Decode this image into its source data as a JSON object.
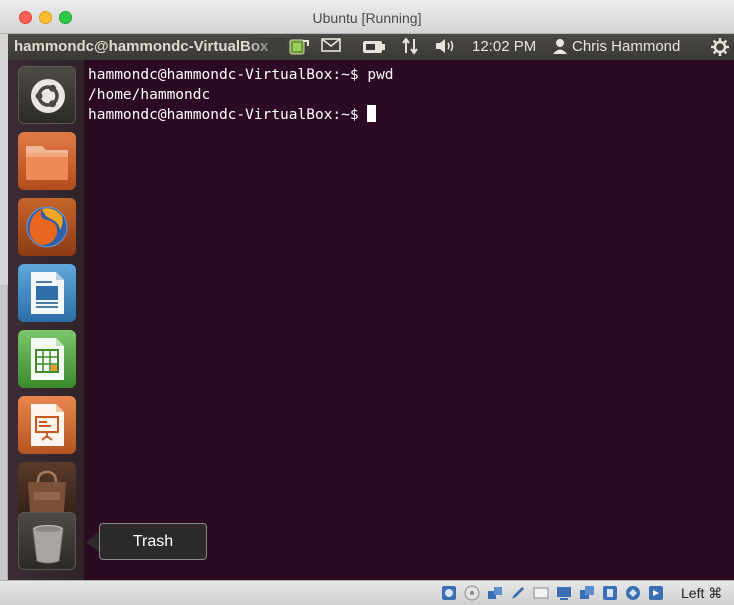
{
  "window": {
    "title": "Ubuntu [Running]"
  },
  "panel": {
    "app_title": "hammondc@hammondc-VirtualBox",
    "clock": "12:02 PM",
    "user": "Chris Hammond",
    "indicators": [
      "updates-icon",
      "mail-icon",
      "battery-icon",
      "network-icon",
      "sound-icon",
      "gear-icon"
    ]
  },
  "launcher": {
    "items": [
      "Dash",
      "Files",
      "Firefox",
      "LibreOffice Writer",
      "LibreOffice Calc",
      "LibreOffice Impress",
      "Ubuntu Software Center",
      "Trash"
    ],
    "tooltip": "Trash"
  },
  "terminal": {
    "lines": [
      "hammondc@hammondc-VirtualBox:~$ pwd",
      "/home/hammondc",
      "hammondc@hammondc-VirtualBox:~$ "
    ]
  },
  "status_bar": {
    "icons": [
      "hard-disk-icon",
      "optical-drive-icon",
      "usb-icon",
      "shared-folders-icon",
      "display-icon",
      "network-icon",
      "video-capture-icon",
      "virtualization-icon",
      "mouse-integration-icon"
    ],
    "host_key": "Left ⌘"
  },
  "colors": {
    "terminal_bg": "#2c0a23",
    "panel_bg": "#3a3935",
    "launcher_bg": "#33262f"
  }
}
